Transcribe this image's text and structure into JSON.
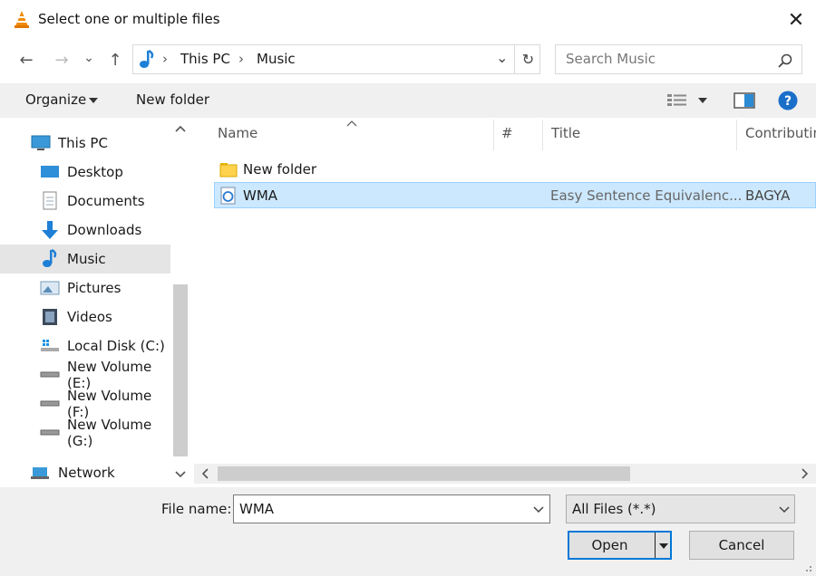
{
  "window": {
    "title": "Select one or multiple files",
    "close_glyph": "✕"
  },
  "nav": {
    "back_glyph": "←",
    "forward_glyph": "→",
    "recent_glyph": "⌄",
    "up_glyph": "↑",
    "breadcrumb": [
      "This PC",
      "Music"
    ],
    "separator": "›",
    "refresh_glyph": "↻",
    "dropdown_glyph": "⌄"
  },
  "search": {
    "placeholder": "Search Music"
  },
  "toolbar": {
    "organize_label": "Organize",
    "new_folder_label": "New folder"
  },
  "sidebar": {
    "items": [
      {
        "label": "This PC",
        "icon": "pc-icon"
      },
      {
        "label": "Desktop",
        "icon": "desktop-icon"
      },
      {
        "label": "Documents",
        "icon": "documents-icon"
      },
      {
        "label": "Downloads",
        "icon": "downloads-icon"
      },
      {
        "label": "Music",
        "icon": "music-icon",
        "selected": true
      },
      {
        "label": "Pictures",
        "icon": "pictures-icon"
      },
      {
        "label": "Videos",
        "icon": "videos-icon"
      },
      {
        "label": "Local Disk (C:)",
        "icon": "local-disk-icon"
      },
      {
        "label": "New Volume (E:)",
        "icon": "drive-icon"
      },
      {
        "label": "New Volume (F:)",
        "icon": "drive-icon"
      },
      {
        "label": "New Volume (G:)",
        "icon": "drive-icon"
      },
      {
        "label": "Network",
        "icon": "network-icon"
      }
    ]
  },
  "columns": {
    "name": "Name",
    "number": "#",
    "title": "Title",
    "contributing": "Contributin"
  },
  "files": [
    {
      "name": "New folder",
      "title": "",
      "contributing": "",
      "icon": "folder-icon",
      "selected": false
    },
    {
      "name": "WMA",
      "title": "Easy Sentence Equivalenc...",
      "contributing": "BAGYA",
      "icon": "media-file-icon",
      "selected": true
    }
  ],
  "footer": {
    "file_name_label": "File name:",
    "file_name_value": "WMA",
    "filter_value": "All Files (*.*)",
    "open_label": "Open",
    "cancel_label": "Cancel"
  },
  "colors": {
    "selection": "#cce8ff",
    "accent": "#0078d7"
  }
}
